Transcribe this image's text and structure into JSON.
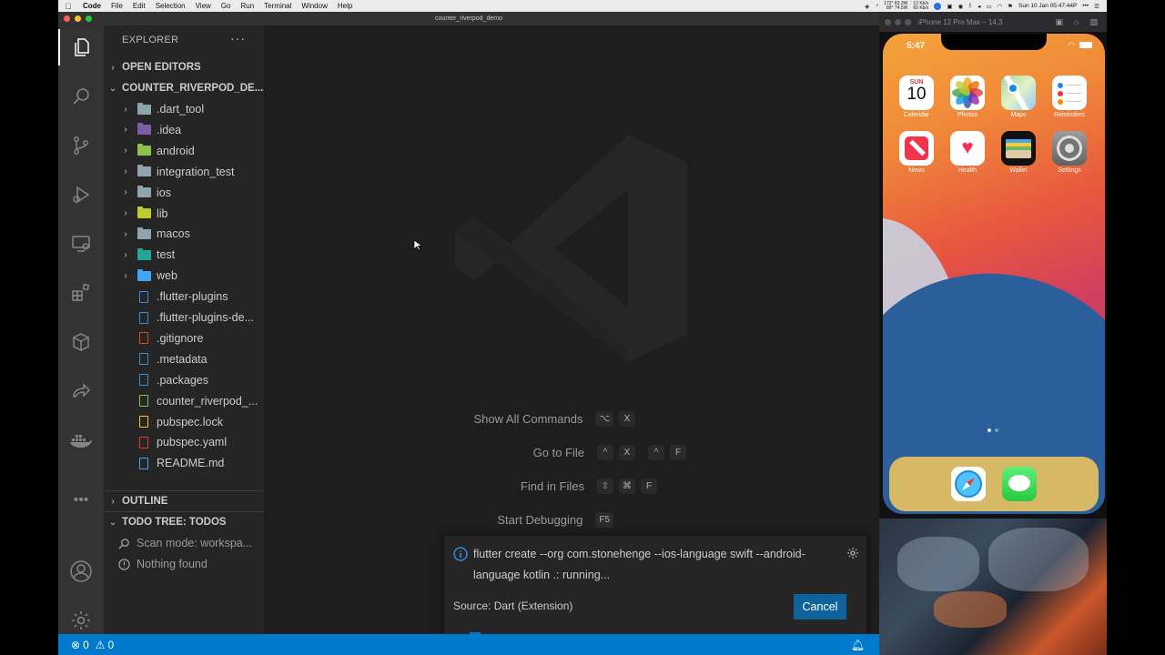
{
  "menubar": {
    "app_name": "Code",
    "items": [
      "File",
      "Edit",
      "Selection",
      "View",
      "Go",
      "Run",
      "Terminal",
      "Window",
      "Help"
    ],
    "stats_1": "172° 83.3W",
    "stats_2": "89° 74.5W",
    "net_1": "12 Kb/s",
    "net_2": "60 Kb/s",
    "datetime": "Sun 10 Jan 05:47:44P"
  },
  "window": {
    "title": "counter_riverpod_demo"
  },
  "sidebar": {
    "title": "EXPLORER",
    "more": "···",
    "open_editors": "OPEN EDITORS",
    "project": "COUNTER_RIVERPOD_DE...",
    "tree": [
      {
        "label": ".dart_tool",
        "type": "folder",
        "color": "#90a4ae"
      },
      {
        "label": ".idea",
        "type": "folder",
        "color": "#7b5ea7"
      },
      {
        "label": "android",
        "type": "folder",
        "color": "#8bc34a"
      },
      {
        "label": "integration_test",
        "type": "folder",
        "color": "#90a4ae"
      },
      {
        "label": "ios",
        "type": "folder",
        "color": "#90a4ae"
      },
      {
        "label": "lib",
        "type": "folder",
        "color": "#c0ca33"
      },
      {
        "label": "macos",
        "type": "folder",
        "color": "#90a4ae"
      },
      {
        "label": "test",
        "type": "folder",
        "color": "#26a69a"
      },
      {
        "label": "web",
        "type": "folder",
        "color": "#42a5f5"
      },
      {
        "label": ".flutter-plugins",
        "type": "file",
        "color": "#3b8fd6"
      },
      {
        "label": ".flutter-plugins-de...",
        "type": "file",
        "color": "#3b8fd6"
      },
      {
        "label": ".gitignore",
        "type": "file",
        "color": "#e64a19"
      },
      {
        "label": ".metadata",
        "type": "file",
        "color": "#3b8fd6"
      },
      {
        "label": ".packages",
        "type": "file",
        "color": "#3b8fd6"
      },
      {
        "label": "counter_riverpod_...",
        "type": "file",
        "color": "#8bc34a"
      },
      {
        "label": "pubspec.lock",
        "type": "file",
        "color": "#fbc02d"
      },
      {
        "label": "pubspec.yaml",
        "type": "file",
        "color": "#e53935"
      },
      {
        "label": "README.md",
        "type": "file",
        "color": "#42a5f5"
      }
    ],
    "outline": "OUTLINE",
    "todo_tree": "TODO TREE: TODOS",
    "scan_mode": "Scan mode: workspa...",
    "nothing_found": "Nothing found"
  },
  "editor": {
    "commands": [
      {
        "label": "Show All Commands",
        "keys": [
          "⌥",
          "X"
        ]
      },
      {
        "label": "Go to File",
        "keys": [
          "^",
          "X",
          "^",
          "F"
        ]
      },
      {
        "label": "Find in Files",
        "keys": [
          "⇧",
          "⌘",
          "F"
        ]
      },
      {
        "label": "Start Debugging",
        "keys": [
          "F5"
        ]
      }
    ]
  },
  "notification": {
    "message": "flutter create --org com.stonehenge --ios-language swift --android-language kotlin .: running...",
    "source": "Source: Dart (Extension)",
    "cancel": "Cancel"
  },
  "statusbar": {
    "errors": "0",
    "warnings": "0"
  },
  "simulator": {
    "title": "iPhone 12 Pro Max – 14.3",
    "time": "5:47",
    "calendar_day": "SUN",
    "calendar_date": "10",
    "apps": [
      "Calendar",
      "Photos",
      "Maps",
      "Reminders",
      "News",
      "Health",
      "Wallet",
      "Settings"
    ]
  },
  "colors": {
    "accent": "#007acc",
    "button": "#0e639c",
    "sidebar_bg": "#252526",
    "editor_bg": "#1e1e1e"
  }
}
